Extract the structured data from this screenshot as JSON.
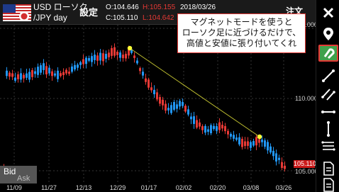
{
  "header": {
    "pair_line1": "USD ローソク",
    "pair_line2": "/JPY  day",
    "settings_label": "設定",
    "open": "O:104.646",
    "high": "H:105.155",
    "date": "2018/03/26",
    "close": "C:105.110",
    "low": "L:104.642",
    "order_label": "注文"
  },
  "callout": {
    "line1": "マグネットモードを使うと",
    "line2": "ローソク足に近づけるだけで、",
    "line3": "高値と安値に張り付いてくれ"
  },
  "price_axis": [
    "115.000",
    "110.000",
    "105.000"
  ],
  "current_price": "105.110",
  "x_axis": [
    "11/09",
    "11/27",
    "12/13",
    "12/29",
    "01/17",
    "02/02",
    "02/20",
    "03/08",
    "03/26"
  ],
  "bid_label": "Bid",
  "ask_label": "Ask",
  "colors": {
    "up": "#e53935",
    "down": "#2196f3",
    "trendline": "#bfbf30",
    "anchor": "#ffff33",
    "highlight": "#3fa14b"
  },
  "toolbar_icons": [
    "close-icon",
    "location-pin-icon",
    "magnet-icon",
    "trendline-icon",
    "channel-icon",
    "horizontal-line-icon",
    "vertical-line-icon",
    "multi-line-icon",
    "document-icon",
    "document-icon"
  ]
}
